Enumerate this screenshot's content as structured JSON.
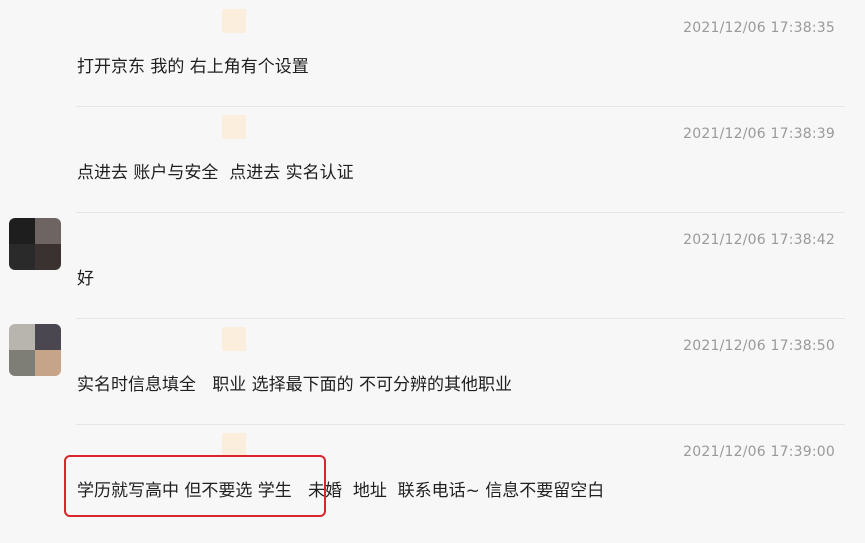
{
  "messages": [
    {
      "timestamp": "2021/12/06 17:38:35",
      "text": "打开京东 我的 右上角有个设置",
      "avatar": null
    },
    {
      "timestamp": "2021/12/06 17:38:39",
      "text": "点进去 账户与安全  点进去 实名认证",
      "avatar": null
    },
    {
      "timestamp": "2021/12/06 17:38:42",
      "text": "好",
      "avatar": {
        "colors": [
          "#1e1e1e",
          "#6e6462",
          "#2a2a2a",
          "#3a3230"
        ]
      }
    },
    {
      "timestamp": "2021/12/06 17:38:50",
      "text": "实名时信息填全   职业 选择最下面的 不可分辨的其他职业",
      "avatar": {
        "colors": [
          "#b7b5ae",
          "#4a4750",
          "#7f7e76",
          "#c6a48a"
        ]
      }
    },
    {
      "timestamp": "2021/12/06 17:39:00",
      "text": "学历就写高中 但不要选 学生   未婚  地址  联系电话~ 信息不要留空白",
      "avatar": null
    }
  ],
  "highlight_color": "#d8262c",
  "name_stub_color": "#fbeedd"
}
